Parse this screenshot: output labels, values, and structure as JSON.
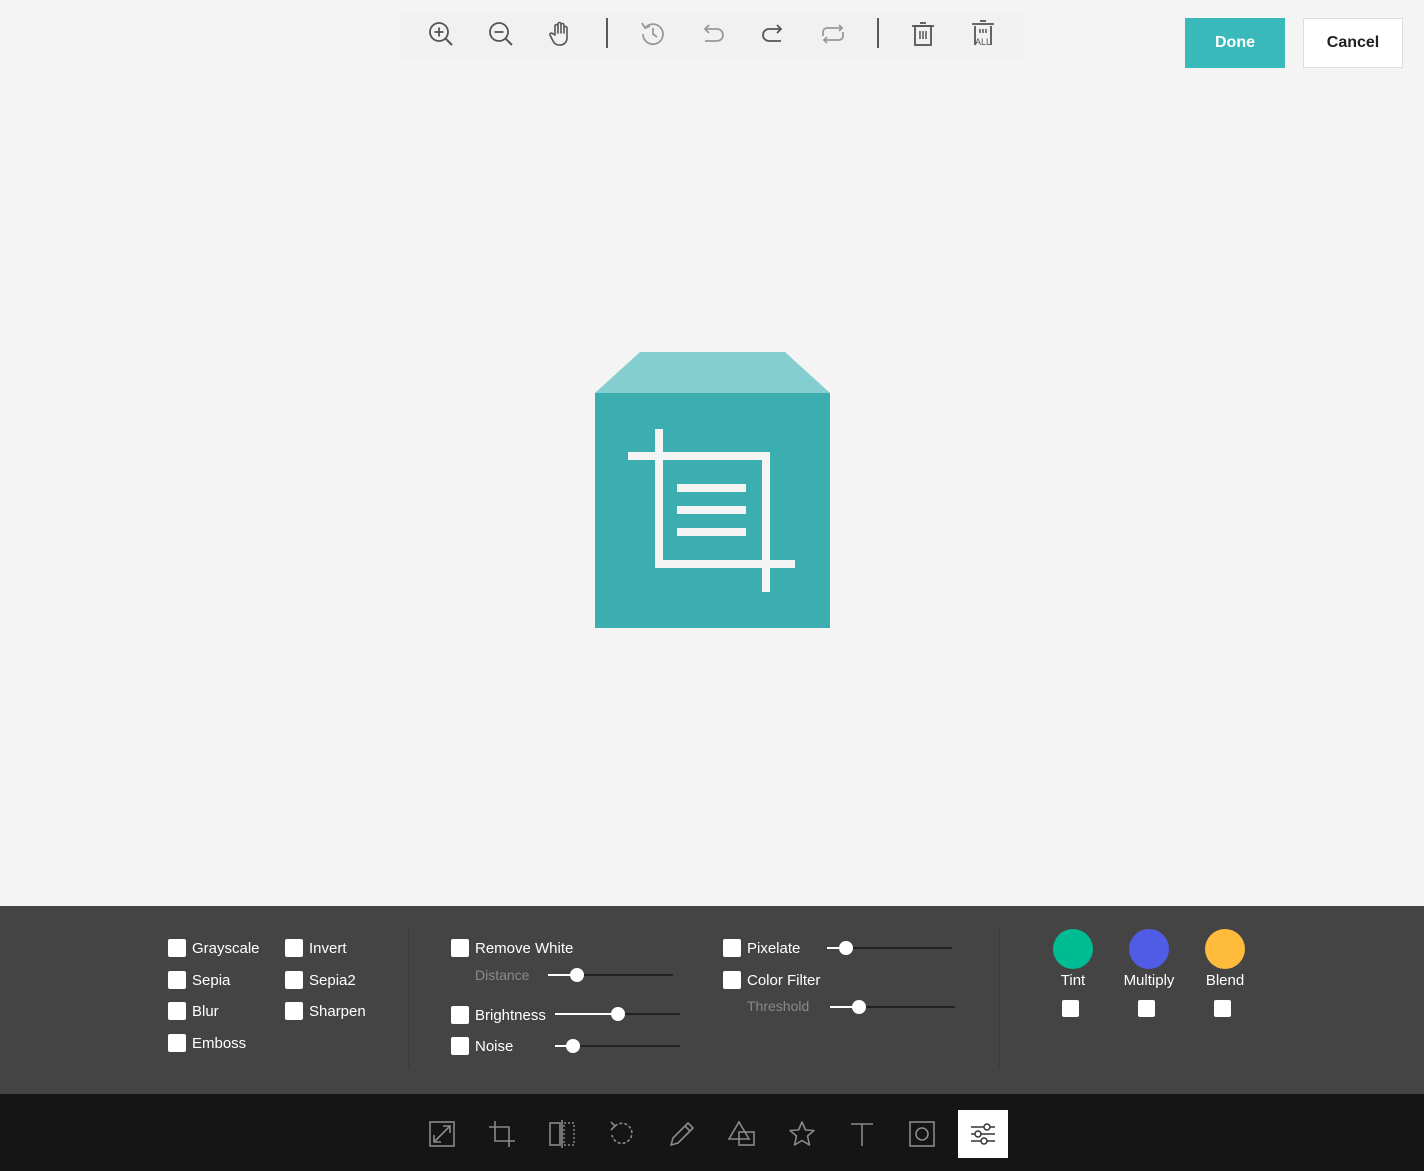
{
  "toolbar": {
    "items": [
      "zoom-in",
      "zoom-out",
      "hand",
      "history",
      "undo",
      "redo",
      "reset",
      "delete",
      "delete-all"
    ]
  },
  "actions": {
    "done_label": "Done",
    "cancel_label": "Cancel"
  },
  "filters": {
    "col1": [
      "Grayscale",
      "Sepia",
      "Blur",
      "Emboss"
    ],
    "col2": [
      "Invert",
      "Sepia2",
      "Sharpen"
    ],
    "remove_white": {
      "label": "Remove White",
      "sub_label": "Distance",
      "value": 0.23
    },
    "brightness": {
      "label": "Brightness",
      "value": 0.5
    },
    "noise": {
      "label": "Noise",
      "value": 0.14
    },
    "pixelate": {
      "label": "Pixelate",
      "value": 0.15
    },
    "color_filter": {
      "label": "Color Filter",
      "sub_label": "Threshold",
      "value": 0.23
    },
    "color_swatches": [
      {
        "label": "Tint",
        "color": "#00bc94"
      },
      {
        "label": "Multiply",
        "color": "#515ce6"
      },
      {
        "label": "Blend",
        "color": "#ffbb3b"
      }
    ]
  },
  "menu": {
    "items": [
      "resize",
      "crop",
      "flip",
      "rotate",
      "draw",
      "shape",
      "icon",
      "text",
      "mask",
      "filter"
    ],
    "active": "filter"
  },
  "colors": {
    "accent": "#3ab9ba",
    "image_top": "#84ced0",
    "image_body": "#3daeb0"
  }
}
